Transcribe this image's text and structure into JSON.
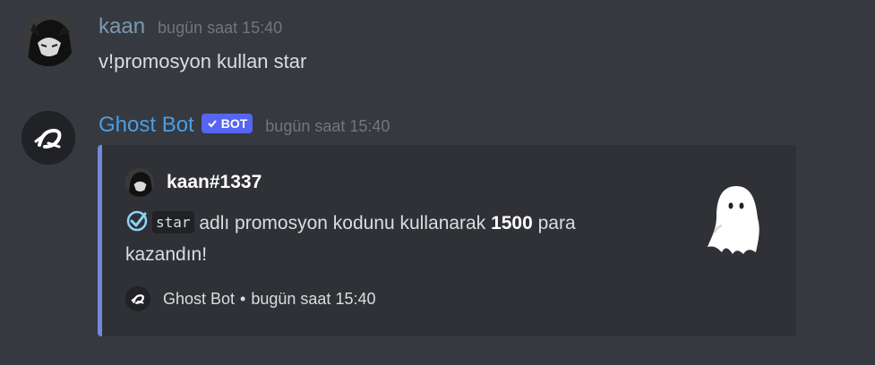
{
  "messages": [
    {
      "username": "kaan",
      "timestamp": "bugün saat 15:40",
      "avatar_icon": "anime-character-avatar",
      "content": "v!promosyon kullan star"
    },
    {
      "username": "Ghost Bot",
      "bot_tag": "BOT",
      "timestamp": "bugün saat 15:40",
      "avatar_icon": "ghost-bot-logo",
      "embed": {
        "accent_color": "#7289da",
        "author": "kaan#1337",
        "description": {
          "code": "star",
          "text_before_amount": " adlı promosyon kodunu kullanarak ",
          "amount": "1500",
          "text_after_amount": " para",
          "line2": "kazandın!"
        },
        "thumbnail_icon": "ghost-icon",
        "footer": {
          "name": "Ghost Bot",
          "separator": "•",
          "timestamp": "bugün saat 15:40"
        }
      }
    }
  ],
  "colors": {
    "background": "#36393f",
    "embed_bg": "#2f3136",
    "bot_tag": "#5865f2",
    "bot_name": "#4b9ee6",
    "user_name": "#7a9aad"
  }
}
